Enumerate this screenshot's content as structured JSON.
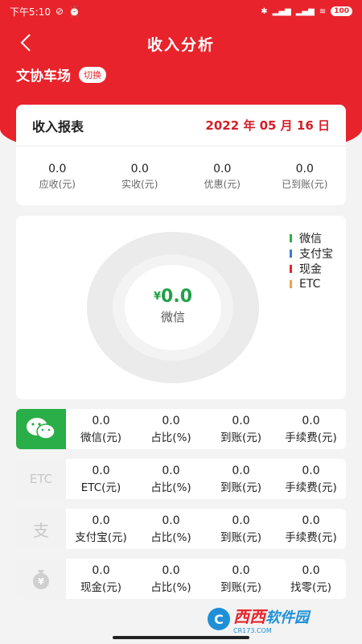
{
  "status_bar": {
    "time": "下午5:10",
    "battery": "100"
  },
  "nav": {
    "title": "收入分析"
  },
  "store": {
    "name": "文协车场",
    "switch_label": "切换"
  },
  "report": {
    "title": "收入报表",
    "date": "2022 年 05 月 16 日",
    "stats": [
      {
        "value": "0.0",
        "label": "应收(元)"
      },
      {
        "value": "0.0",
        "label": "实收(元)"
      },
      {
        "value": "0.0",
        "label": "优惠(元)"
      },
      {
        "value": "0.0",
        "label": "已到账(元)"
      }
    ]
  },
  "chart_data": {
    "type": "pie",
    "categories": [
      "微信",
      "支付宝",
      "现金",
      "ETC"
    ],
    "values": [
      0,
      0,
      0,
      0
    ],
    "center_value": "0.0",
    "center_currency": "¥",
    "center_label": "微信",
    "colors": [
      "#2aae47",
      "#3a7bd5",
      "#e8232b",
      "#f0a04b"
    ],
    "legend_position": "top-right"
  },
  "payments": [
    {
      "icon": "wechat-icon",
      "cells": [
        {
          "value": "0.0",
          "label": "微信(元)"
        },
        {
          "value": "0.0",
          "label": "占比(%)"
        },
        {
          "value": "0.0",
          "label": "到账(元)"
        },
        {
          "value": "0.0",
          "label": "手续费(元)"
        }
      ]
    },
    {
      "icon": "etc-icon",
      "icon_text": "ETC",
      "cells": [
        {
          "value": "0.0",
          "label": "ETC(元)"
        },
        {
          "value": "0.0",
          "label": "占比(%)"
        },
        {
          "value": "0.0",
          "label": "到账(元)"
        },
        {
          "value": "0.0",
          "label": "手续费(元)"
        }
      ]
    },
    {
      "icon": "alipay-icon",
      "icon_text": "支",
      "cells": [
        {
          "value": "0.0",
          "label": "支付宝(元)"
        },
        {
          "value": "0.0",
          "label": "占比(%)"
        },
        {
          "value": "0.0",
          "label": "到账(元)"
        },
        {
          "value": "0.0",
          "label": "手续费(元)"
        }
      ]
    },
    {
      "icon": "cash-bag-icon",
      "icon_text": "¥",
      "cells": [
        {
          "value": "0.0",
          "label": "现金(元)"
        },
        {
          "value": "0.0",
          "label": "占比(%)"
        },
        {
          "value": "0.0",
          "label": "到账(元)"
        },
        {
          "value": "0.0",
          "label": "找零(元)"
        }
      ]
    }
  ],
  "watermark": {
    "badge": "C",
    "text": "西西",
    "sub": "软件园",
    "small": "CR173.COM"
  }
}
